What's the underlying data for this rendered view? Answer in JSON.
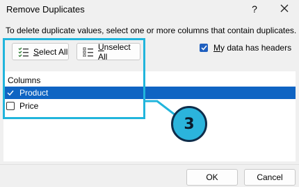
{
  "dialog": {
    "title": "Remove Duplicates",
    "help_glyph": "?",
    "instruction": "To delete duplicate values, select one or more columns that contain duplicates."
  },
  "toolbar": {
    "select_all_access": "S",
    "select_all_rest": "elect All",
    "unselect_all_access": "U",
    "unselect_all_rest": "nselect All"
  },
  "headers_option": {
    "label_access": "M",
    "label_rest": "y data has headers",
    "checked": true
  },
  "columns": {
    "header": "Columns",
    "items": [
      {
        "label": "Product",
        "checked": true,
        "selected": true
      },
      {
        "label": "Price",
        "checked": false,
        "selected": false
      }
    ]
  },
  "annotation": {
    "step": "3",
    "color": "#2bb4dc"
  },
  "footer": {
    "ok_label": "OK",
    "cancel_label": "Cancel"
  },
  "colors": {
    "selection": "#0f64c3",
    "checkbox": "#1f5fbf"
  }
}
